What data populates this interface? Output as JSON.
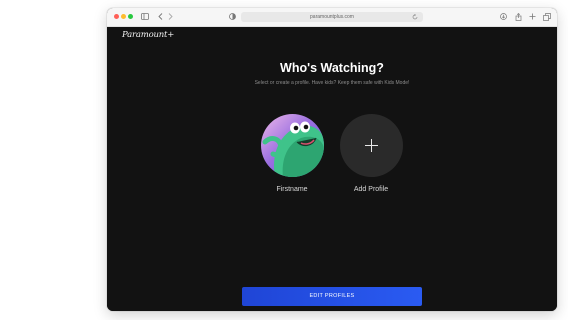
{
  "browser": {
    "url": "paramountplus.com",
    "colors": {
      "close": "#ff5f57",
      "minimize": "#febc2e",
      "maximize": "#28c840"
    },
    "icons": [
      "sidebar-icon",
      "back-icon",
      "forward-icon",
      "shield-icon",
      "reload-icon",
      "download-icon",
      "share-icon",
      "new-tab-icon",
      "tabs-icon"
    ]
  },
  "app": {
    "logo": "Paramount+",
    "heading": "Who's Watching?",
    "subheading": "Select or create a profile. Have kids? Keep them safe with Kids Mode!",
    "profiles": [
      {
        "name": "Firstname",
        "avatar": "green-character-avatar"
      }
    ],
    "add_profile_label": "Add Profile",
    "edit_button_label": "EDIT PROFILES",
    "colors": {
      "background": "#121212",
      "button": "#2a5bf2",
      "add_circle": "#2a2a2a"
    }
  }
}
